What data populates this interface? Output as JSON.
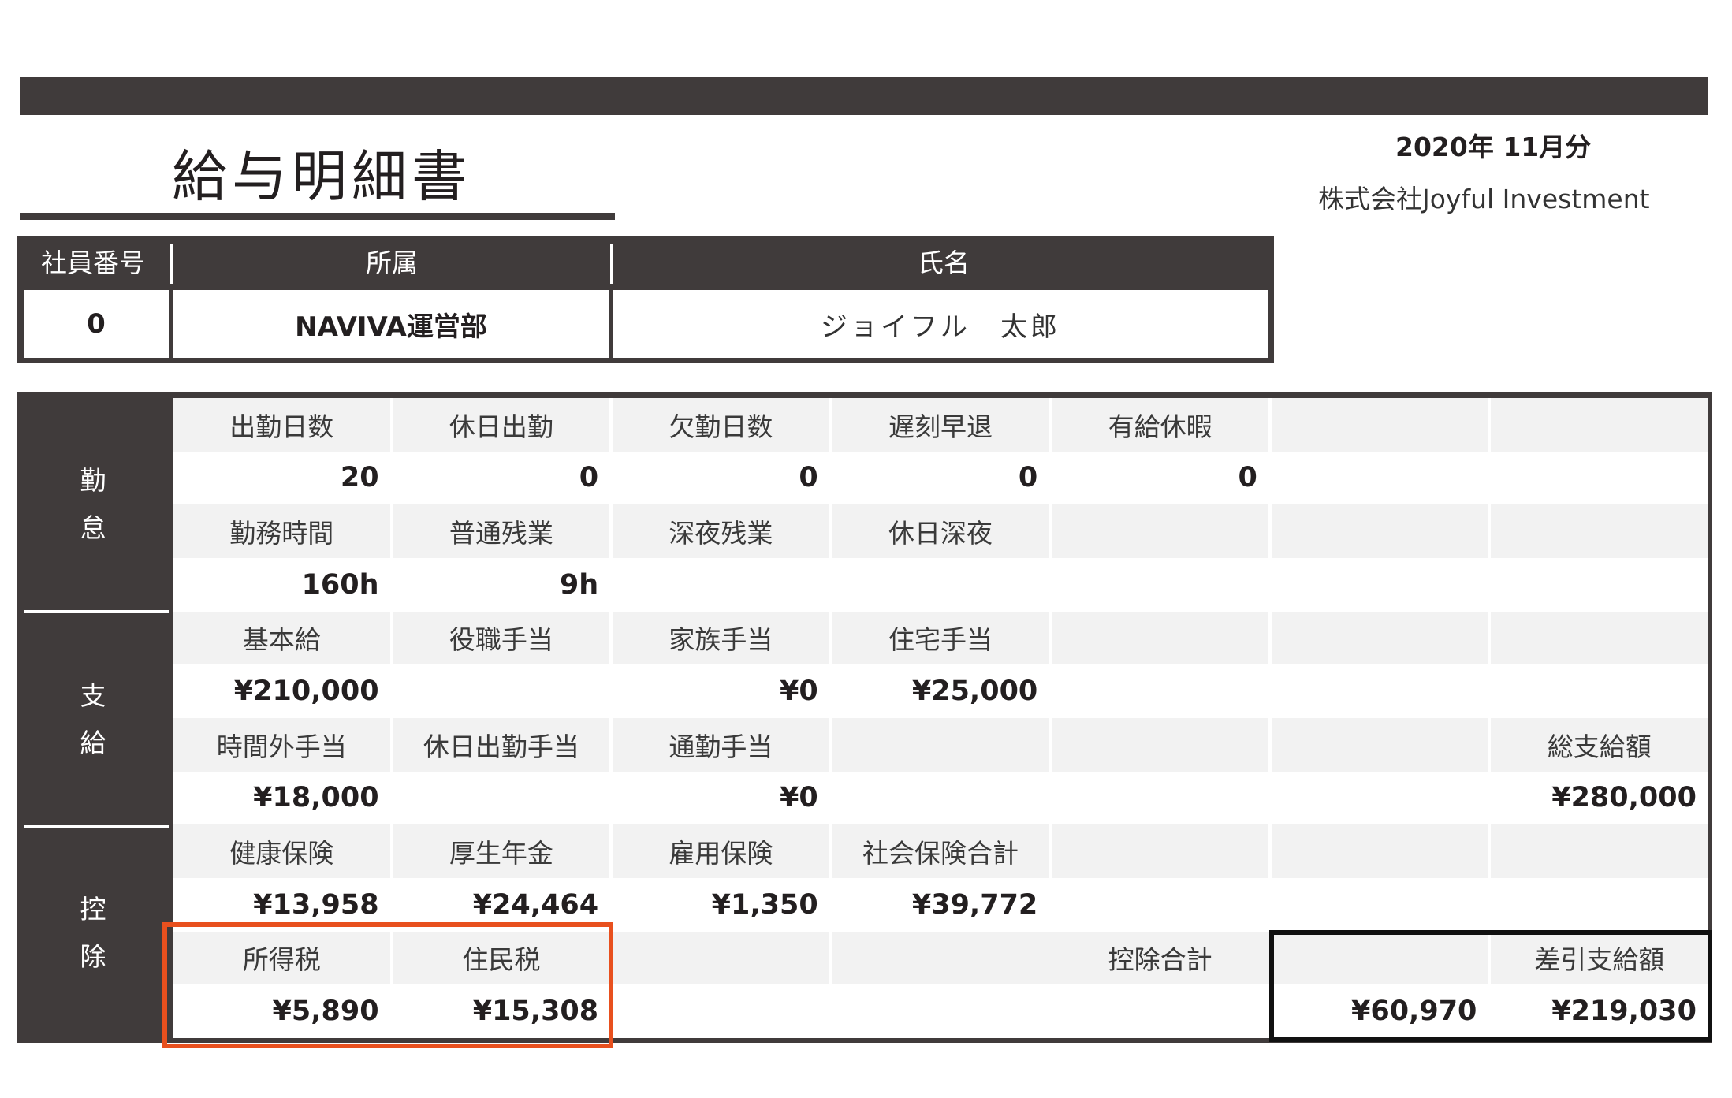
{
  "header": {
    "title": "給与明細書",
    "period": "2020年 11月分",
    "company": "株式会社Joyful Investment"
  },
  "employee": {
    "id_label": "社員番号",
    "dept_label": "所属",
    "name_label": "氏名",
    "id": "0",
    "dept": "NAVIVA運営部",
    "name": "ジョイフル　太郎"
  },
  "categories": {
    "attendance": [
      "勤",
      "怠"
    ],
    "payment": [
      "支",
      "給"
    ],
    "deduction": [
      "控",
      "除"
    ]
  },
  "rows": [
    [
      "出勤日数",
      "休日出勤",
      "欠勤日数",
      "遅刻早退",
      "有給休暇",
      "",
      ""
    ],
    [
      "20",
      "0",
      "0",
      "0",
      "0",
      "",
      ""
    ],
    [
      "勤務時間",
      "普通残業",
      "深夜残業",
      "休日深夜",
      "",
      "",
      ""
    ],
    [
      "160h",
      "9h",
      "",
      "",
      "",
      "",
      ""
    ],
    [
      "基本給",
      "役職手当",
      "家族手当",
      "住宅手当",
      "",
      "",
      ""
    ],
    [
      "¥210,000",
      "",
      "¥0",
      "¥25,000",
      "",
      "",
      ""
    ],
    [
      "時間外手当",
      "休日出勤手当",
      "通勤手当",
      "",
      "",
      "",
      "総支給額"
    ],
    [
      "¥18,000",
      "",
      "¥0",
      "",
      "",
      "",
      "¥280,000"
    ],
    [
      "健康保険",
      "厚生年金",
      "雇用保険",
      "社会保険合計",
      "",
      "",
      ""
    ],
    [
      "¥13,958",
      "¥24,464",
      "¥1,350",
      "¥39,772",
      "",
      "",
      ""
    ]
  ],
  "totals": {
    "income_tax_label": "所得税",
    "resident_tax_label": "住民税",
    "deduction_total_label": "控除合計",
    "net_pay_label": "差引支給額",
    "income_tax": "¥5,890",
    "resident_tax": "¥15,308",
    "deduction_total": "¥60,970",
    "net_pay": "¥219,030"
  },
  "colors": {
    "dark": "#403b3b",
    "label_bg": "#f2f2f2",
    "highlight": "#e8501e"
  }
}
